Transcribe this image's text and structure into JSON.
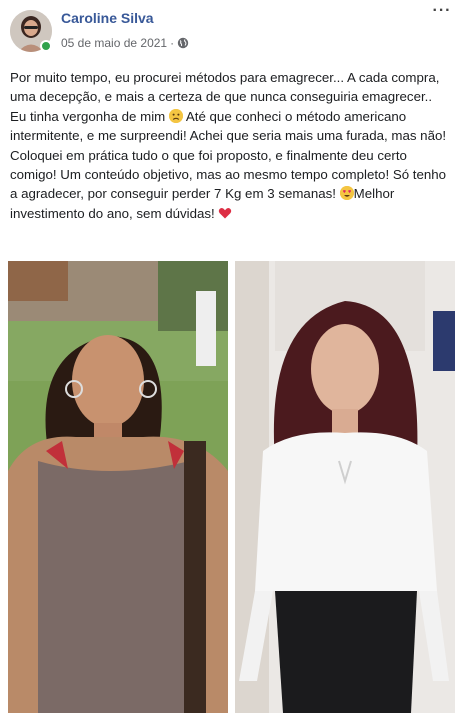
{
  "post": {
    "author": "Caroline Silva",
    "date": "05 de maio de 2021",
    "separator": "·",
    "privacy_icon": "globe-icon",
    "more_label": "···",
    "text_parts": {
      "p1": "Por muito tempo, eu procurei métodos para emagrecer... A cada compra, uma decepção, e mais a certeza de que nunca conseguiria emagrecer.. Eu tinha vergonha de mim ",
      "p2": " Até que conheci o método americano intermitente, e me surpreendi! Achei que seria mais uma furada, mas não! Coloquei em prática tudo o que foi proposto, e finalmente deu certo comigo! Um conteúdo objetivo, mas ao mesmo tempo completo! Só tenho a agradecer, por conseguir perder 7 Kg em 3 semanas! ",
      "p3": "Melhor investimento do ano, sem dúvidas! "
    },
    "emojis": [
      "sad-face-emoji",
      "heart-eyes-emoji",
      "red-heart-emoji"
    ],
    "photos": [
      {
        "name": "before-photo",
        "icon": "person-photo"
      },
      {
        "name": "after-photo",
        "icon": "person-photo"
      }
    ]
  },
  "colors": {
    "author_link": "#385898",
    "online": "#31a24c",
    "meta_text": "#65676b"
  }
}
